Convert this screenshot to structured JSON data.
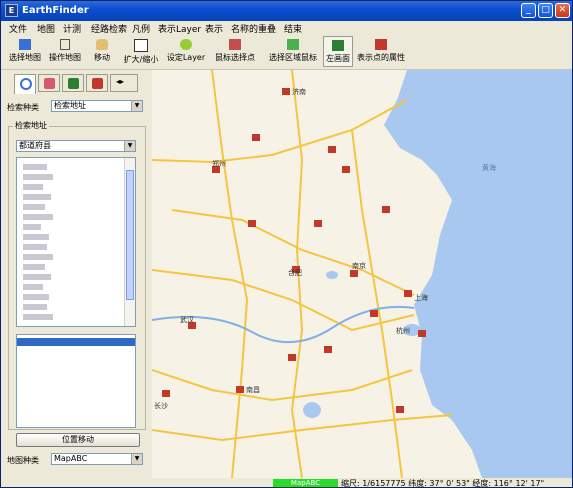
{
  "window": {
    "title": "EarthFinder",
    "minimize": "_",
    "maximize": "□",
    "close": "✕"
  },
  "menu": [
    "文件",
    "地图",
    "计测",
    "经路检索",
    "凡例",
    "表示Layer",
    "表示",
    "名称的重叠",
    "结束"
  ],
  "toolbar": [
    {
      "label": "选择地图",
      "icon": "map-icon",
      "color": "#3a6fd8"
    },
    {
      "label": "操作地图",
      "icon": "pointer-icon",
      "color": "#555555"
    },
    {
      "label": "移动",
      "icon": "hand-icon",
      "color": "#e0c070"
    },
    {
      "label": "扩大/缩小",
      "icon": "zoom-box-icon",
      "color": "#ffffff"
    },
    {
      "label": "设定Layer",
      "icon": "layer-icon",
      "color": "#9acd32"
    },
    {
      "label": "鼠标选择点",
      "icon": "point-select-icon",
      "color": "#c0504d"
    },
    {
      "label": "选择区域鼠标",
      "icon": "area-select-icon",
      "color": "#4caf50"
    },
    {
      "label": "左画面",
      "icon": "left-pane-icon",
      "color": "#2e7d32"
    },
    {
      "label": "表示点的属性",
      "icon": "attribute-icon",
      "color": "#c0392b"
    }
  ],
  "left_panel": {
    "search_type_label": "检索种类",
    "search_type_value": "检索地址",
    "group_label": "检索地址",
    "province_value": "都道府县",
    "move_button": "位置移动",
    "map_type_label": "地图种类",
    "map_type_value": "MapABC"
  },
  "map": {
    "sea_label": "黄海",
    "land_color": "#f6f2e6",
    "sea_color": "#a9c8ef",
    "cities": [
      {
        "name": "济南"
      },
      {
        "name": "合肥"
      },
      {
        "name": "南京"
      },
      {
        "name": "上海"
      },
      {
        "name": "武汉"
      },
      {
        "name": "杭州"
      },
      {
        "name": "南昌"
      },
      {
        "name": "长沙"
      },
      {
        "name": "郑州"
      }
    ]
  },
  "status": {
    "provider": "MapABC",
    "readout": "缩尺: 1/6157775  纬度: 37° 0' 53\"  经度: 116° 12' 17\""
  }
}
